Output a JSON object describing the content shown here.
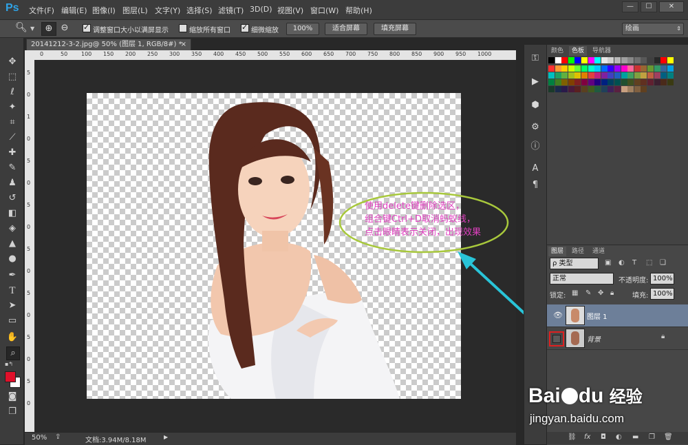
{
  "app": {
    "logo": "Ps"
  },
  "menu": [
    "文件(F)",
    "编辑(E)",
    "图像(I)",
    "图层(L)",
    "文字(Y)",
    "选择(S)",
    "滤镜(T)",
    "3D(D)",
    "视图(V)",
    "窗口(W)",
    "帮助(H)"
  ],
  "window_controls": {
    "minimize": "—",
    "restore": "☐",
    "close": "✕"
  },
  "options": {
    "resize_windows_label": "调整窗口大小以满屏显示",
    "zoom_all_label": "缩放所有窗口",
    "scrubby_label": "细微缩放",
    "zoom_pct": "100%",
    "fit_screen": "适合屏幕",
    "fill_screen": "填充屏幕",
    "workspace": "绘画"
  },
  "document": {
    "tab_title": "20141212-3-2.jpg@ 50% (图层 1, RGB/8#) *",
    "close": "×"
  },
  "ruler": {
    "h_ticks": [
      "0",
      "50",
      "100",
      "150",
      "200",
      "250",
      "300",
      "350",
      "400",
      "450",
      "500",
      "550",
      "600",
      "650",
      "700",
      "750",
      "800",
      "850",
      "900",
      "950",
      "1000"
    ],
    "v_ticks": [
      "5",
      "0",
      "1",
      "0",
      "5",
      "0",
      "5",
      "0",
      "5",
      "0",
      "5",
      "0",
      "5",
      "0",
      "5",
      "0"
    ]
  },
  "annotation": {
    "line1": "使用delete键删除选区，",
    "line2": "组合键Ctrl+D取消蚂蚁线，",
    "line3": "点击眼睛表示关闭，出现效果",
    "color": "#e040c0",
    "ellipse_color": "#a8c83c",
    "arrow_color": "#29c4d8"
  },
  "status": {
    "zoom": "50%",
    "doc_size": "文档:3.94M/8.18M"
  },
  "panel_tabs": {
    "color": "颜色",
    "swatches": "色板",
    "navigator": "导航器"
  },
  "layers_tabs": {
    "layers": "图层",
    "paths": "路径",
    "channels": "通道"
  },
  "layers": {
    "filter_kind": "ρ 类型",
    "blend_mode": "正常",
    "opacity_label": "不透明度:",
    "opacity": "100%",
    "lock_label": "锁定:",
    "fill_label": "填充:",
    "fill": "100%",
    "items": [
      {
        "name": "图层 1",
        "selected": true,
        "visible": true
      },
      {
        "name": "背景",
        "selected": false,
        "visible": false,
        "locked": true
      }
    ]
  },
  "watermark": {
    "brand": "Bai",
    "brand2": "du",
    "cn": "经验",
    "url": "jingyan.baidu.com"
  },
  "colors": {
    "fg": "#e0102a",
    "bg": "#ffffff",
    "eye_off_border": "#e02020"
  },
  "swatch_colors": [
    "#000000",
    "#ffffff",
    "#ff0000",
    "#00ff00",
    "#0000ff",
    "#ffff00",
    "#ff00ff",
    "#00ffff",
    "#e8e8e8",
    "#d0d0d0",
    "#b8b8b8",
    "#a0a0a0",
    "#888888",
    "#707070",
    "#585858",
    "#404040",
    "#282828",
    "#ff0000",
    "#ffff00",
    "#ff3030",
    "#ff9933",
    "#ffcc00",
    "#ccff00",
    "#66ff33",
    "#00ff66",
    "#00ffcc",
    "#00ccff",
    "#0066ff",
    "#3300ff",
    "#9900ff",
    "#ff00cc",
    "#ff6699",
    "#cc3333",
    "#996633",
    "#669933",
    "#339966",
    "#336699",
    "#00a0e0",
    "#00c0c0",
    "#20a060",
    "#60b040",
    "#a0c020",
    "#e0c000",
    "#e08000",
    "#e04040",
    "#c02080",
    "#8020a0",
    "#4040c0",
    "#2060c0",
    "#00a0a0",
    "#40a060",
    "#80a040",
    "#c0a040",
    "#c06040",
    "#a04060",
    "#006080",
    "#008080",
    "#008040",
    "#408020",
    "#806000",
    "#804000",
    "#802020",
    "#800040",
    "#600080",
    "#200080",
    "#002080",
    "#004060",
    "#005050",
    "#205030",
    "#405020",
    "#604020",
    "#603020",
    "#602030",
    "#3c2030",
    "#4a2a1a",
    "#3a3a12",
    "#1a3a2a",
    "#1a2a4a",
    "#2a1a4a",
    "#4a1a3a",
    "#5a2020",
    "#5a4020",
    "#405a20",
    "#205a40",
    "#20405a",
    "#40205a",
    "#5a2040",
    "#c8a080",
    "#a08060",
    "#806040",
    "#604020"
  ]
}
